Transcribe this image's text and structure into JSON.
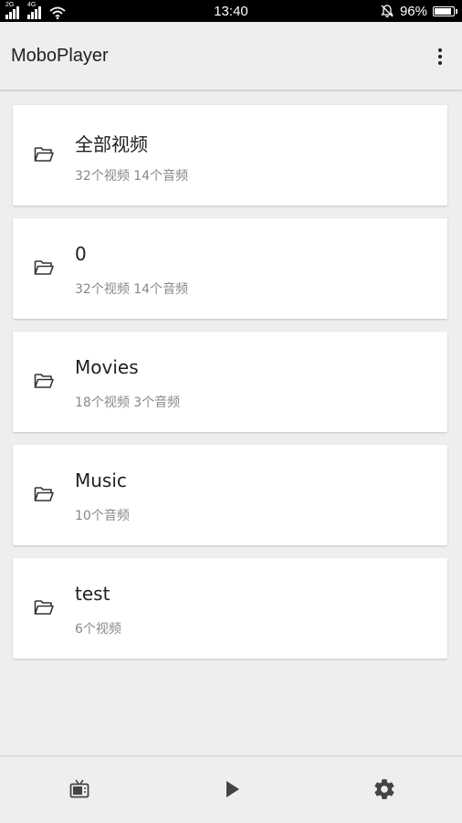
{
  "status_bar": {
    "net1": "2G",
    "net2": "4G",
    "time": "13:40",
    "battery": "96%",
    "battery_level": 0.96
  },
  "app_bar": {
    "title": "MoboPlayer",
    "menu_icon": "more-vert-icon"
  },
  "folders": [
    {
      "name": "全部视频",
      "info": "32个视频  14个音频",
      "icon": "folder-open-icon"
    },
    {
      "name": "0",
      "info": "32个视频  14个音频",
      "icon": "folder-open-icon"
    },
    {
      "name": "Movies",
      "info": "18个视频  3个音频",
      "icon": "folder-open-icon"
    },
    {
      "name": "Music",
      "info": "10个音频",
      "icon": "folder-open-icon"
    },
    {
      "name": "test",
      "info": "6个视频",
      "icon": "folder-open-icon"
    }
  ],
  "bottom_nav": {
    "items": [
      {
        "icon": "tv-icon"
      },
      {
        "icon": "play-icon"
      },
      {
        "icon": "settings-gear-icon"
      }
    ]
  },
  "colors": {
    "background": "#eeeeee",
    "card": "#ffffff",
    "primary_text": "#212121",
    "secondary_text": "#888888",
    "status_bar": "#000000"
  }
}
